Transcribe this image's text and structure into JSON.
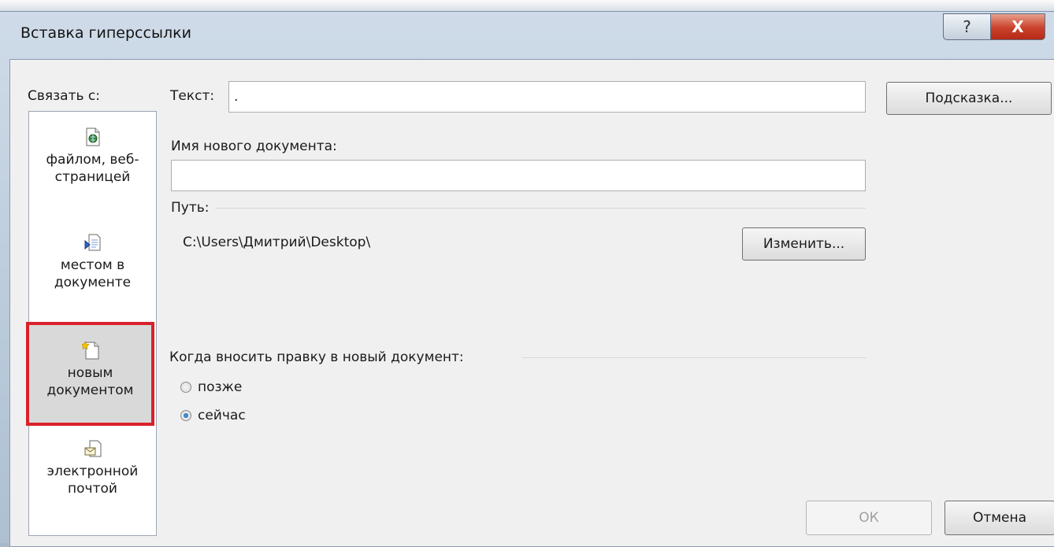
{
  "window": {
    "title": "Вставка гиперссылки",
    "help_label": "?",
    "close_label": "X"
  },
  "link_with_label": "Связать с:",
  "sidebar": {
    "items": [
      {
        "line1": "файлом, веб-",
        "line2": "страницей",
        "icon": "file-web-page-icon"
      },
      {
        "line1": "местом в",
        "line2": "документе",
        "icon": "place-in-document-icon"
      },
      {
        "line1": "новым",
        "line2": "документом",
        "icon": "new-document-icon",
        "selected": true
      },
      {
        "line1": "электронной",
        "line2": "почтой",
        "icon": "email-icon"
      }
    ]
  },
  "text_label": "Текст:",
  "text_value": ".",
  "tooltip_button": "Подсказка...",
  "new_doc_name_label": "Имя нового документа:",
  "new_doc_name_value": "",
  "path_label": "Путь:",
  "path_value": "C:\\Users\\Дмитрий\\Desktop\\",
  "change_button": "Изменить...",
  "edit_when_label": "Когда вносить правку в новый документ:",
  "radio_later": "позже",
  "radio_now": "сейчас",
  "ok_button": "ОК",
  "cancel_button": "Отмена"
}
